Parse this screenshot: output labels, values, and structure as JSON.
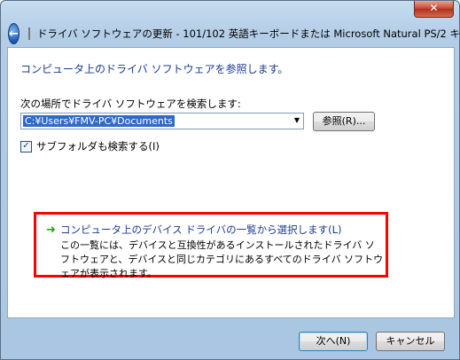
{
  "window": {
    "title": "ドライバ ソフトウェアの更新 - 101/102 英語キーボードまたは Microsoft Natural PS/2 キーボード",
    "close_symbol": "✕"
  },
  "header": {
    "back_symbol": "←"
  },
  "main": {
    "heading": "コンピュータ上のドライバ ソフトウェアを参照します。",
    "search_label": "次の場所でドライバ ソフトウェアを検索します:",
    "path_value": "C:¥Users¥FMV-PC¥Documents",
    "dropdown_symbol": "▼",
    "browse_label": "参照(R)...",
    "include_subfolders_label": "サブフォルダも検索する(I)",
    "include_subfolders_checked": "✓"
  },
  "option": {
    "arrow_symbol": "➜",
    "title": "コンピュータ上のデバイス ドライバの一覧から選択します(L)",
    "description": "この一覧には、デバイスと互換性があるインストールされたドライバ ソフトウェアと、デバイスと同じカテゴリにあるすべてのドライバ ソフトウェアが表示されます。",
    "highlight_color": "#ff0000"
  },
  "footer": {
    "next_label": "次へ(N)",
    "cancel_label": "キャンセル"
  }
}
